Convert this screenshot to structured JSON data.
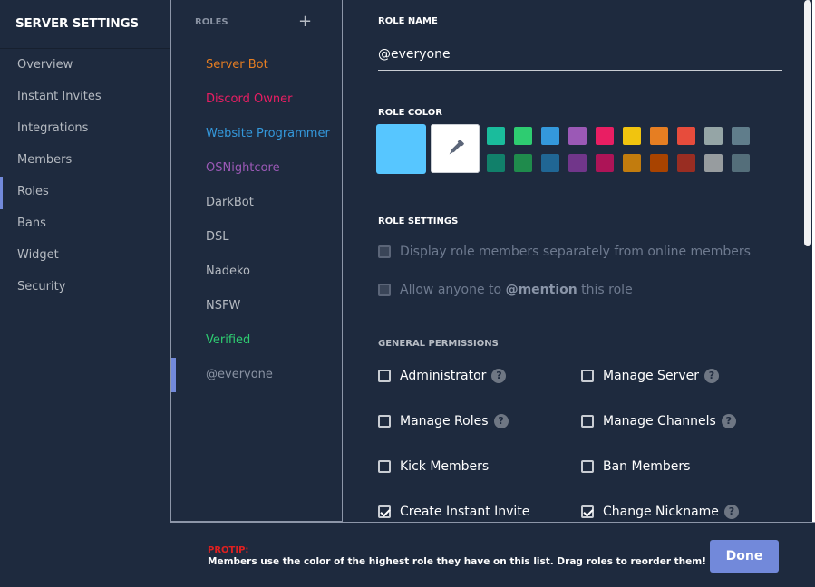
{
  "sidebar": {
    "title": "SERVER SETTINGS",
    "items": [
      {
        "label": "Overview"
      },
      {
        "label": "Instant Invites"
      },
      {
        "label": "Integrations"
      },
      {
        "label": "Members"
      },
      {
        "label": "Roles"
      },
      {
        "label": "Bans"
      },
      {
        "label": "Widget"
      },
      {
        "label": "Security"
      }
    ],
    "active": "Roles"
  },
  "roles": {
    "header": "ROLES",
    "add_icon": "plus-icon",
    "items": [
      {
        "label": "Server Bot",
        "color": "#e67e22"
      },
      {
        "label": "Discord Owner",
        "color": "#e91e63"
      },
      {
        "label": "Website Programmer",
        "color": "#3498db"
      },
      {
        "label": "OSNightcore",
        "color": "#9b59b6"
      },
      {
        "label": "DarkBot",
        "color": "#b5bac1"
      },
      {
        "label": "DSL",
        "color": "#b5bac1"
      },
      {
        "label": "Nadeko",
        "color": "#b5bac1"
      },
      {
        "label": "NSFW",
        "color": "#b5bac1"
      },
      {
        "label": "Verified",
        "color": "#2ecc71"
      },
      {
        "label": "@everyone",
        "color": "#8a93a3"
      }
    ],
    "selected": "@everyone"
  },
  "main": {
    "role_name_label": "ROLE NAME",
    "role_name_value": "@everyone",
    "role_color_label": "ROLE COLOR",
    "selected_color": "#57c6ff",
    "picker_icon": "eyedropper-icon",
    "swatches_row1": [
      "#1abc9c",
      "#2ecc71",
      "#3498db",
      "#9b59b6",
      "#e91e63",
      "#f1c40f",
      "#e67e22",
      "#e74c3c",
      "#95a5a6",
      "#607d8b"
    ],
    "swatches_row2": [
      "#11806a",
      "#1f8b4c",
      "#206694",
      "#71368a",
      "#ad1457",
      "#c27c0e",
      "#a84300",
      "#992d22",
      "#979c9f",
      "#546e7a"
    ],
    "role_settings_label": "ROLE SETTINGS",
    "settings": [
      {
        "label": "Display role members separately from online members"
      },
      {
        "pre": "Allow anyone to ",
        "bold": "@mention",
        "post": " this role"
      }
    ],
    "general_permissions_label": "GENERAL PERMISSIONS",
    "permissions": {
      "administrator": {
        "label": "Administrator",
        "checked": false,
        "help": "?"
      },
      "manage_server": {
        "label": "Manage Server",
        "checked": false,
        "help": "?"
      },
      "manage_roles": {
        "label": "Manage Roles",
        "checked": false,
        "help": "?"
      },
      "manage_channels": {
        "label": "Manage Channels",
        "checked": false,
        "help": "?"
      },
      "kick_members": {
        "label": "Kick Members",
        "checked": false
      },
      "ban_members": {
        "label": "Ban Members",
        "checked": false
      },
      "create_instant_invite": {
        "label": "Create Instant Invite",
        "checked": true
      },
      "change_nickname": {
        "label": "Change Nickname",
        "checked": true,
        "help": "?"
      }
    }
  },
  "footer": {
    "protip_label": "PROTIP:",
    "protip_text": "Members use the color of the highest role they have on this list. Drag roles to reorder them!",
    "done_label": "Done"
  }
}
